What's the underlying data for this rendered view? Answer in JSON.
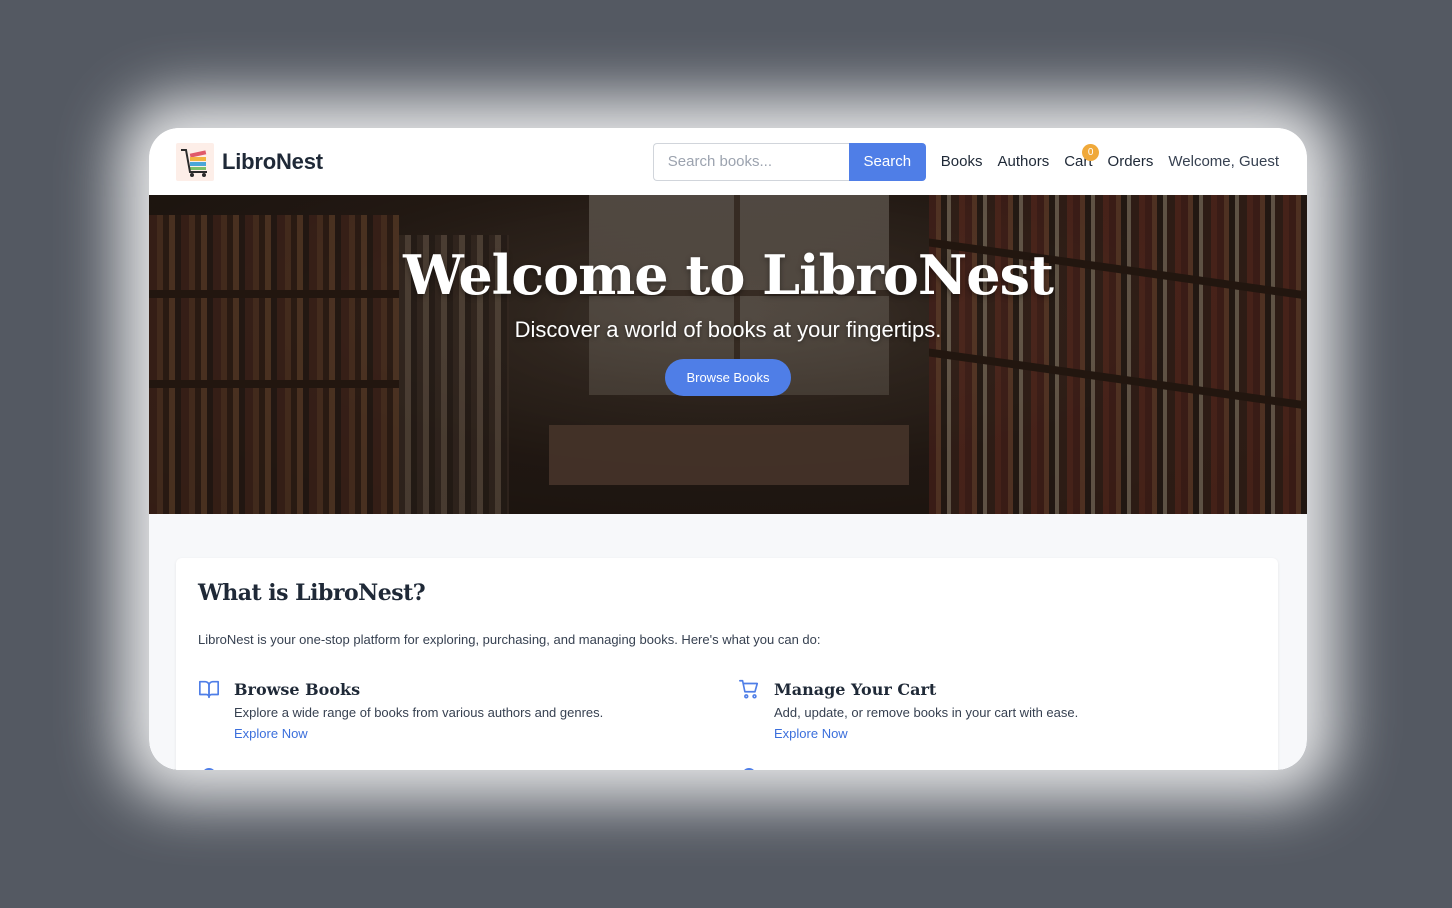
{
  "header": {
    "brand": "LibroNest",
    "search_placeholder": "Search books...",
    "search_button": "Search",
    "nav": {
      "books": "Books",
      "authors": "Authors",
      "cart": "Cart",
      "cart_count": "0",
      "orders": "Orders",
      "welcome": "Welcome, Guest"
    }
  },
  "hero": {
    "title": "Welcome to LibroNest",
    "subtitle": "Discover a world of books at your fingertips.",
    "button": "Browse Books"
  },
  "about": {
    "title": "What is LibroNest?",
    "description": "LibroNest is your one-stop platform for exploring, purchasing, and managing books. Here's what you can do:",
    "features": [
      {
        "icon": "book-open-icon",
        "title": "Browse Books",
        "description": "Explore a wide range of books from various authors and genres.",
        "link": "Explore Now"
      },
      {
        "icon": "cart-icon",
        "title": "Manage Your Cart",
        "description": "Add, update, or remove books in your cart with ease.",
        "link": "Explore Now"
      }
    ]
  },
  "colors": {
    "primary": "#4f7ee7",
    "badge": "#f0a93a",
    "link": "#3b6fdc"
  }
}
